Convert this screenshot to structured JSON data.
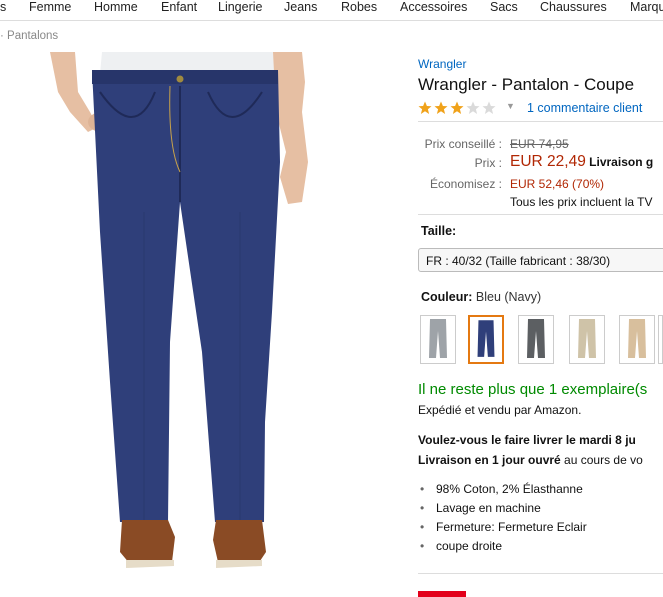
{
  "nav": {
    "items": [
      "s",
      "Femme",
      "Homme",
      "Enfant",
      "Lingerie",
      "Jeans",
      "Robes",
      "Accessoires",
      "Sacs",
      "Chaussures",
      "Marqu"
    ]
  },
  "breadcrumb": "· Pantalons",
  "product": {
    "brand": "Wrangler",
    "title": "Wrangler - Pantalon - Coupe",
    "rating": 3,
    "rating_max": 5,
    "reviews": "1 commentaire client"
  },
  "price": {
    "list_label": "Prix conseillé :",
    "list_value": "EUR 74,95",
    "price_label": "Prix :",
    "price_value": "EUR 22,49",
    "shipping": "Livraison g",
    "save_label": "Économisez :",
    "save_value": "EUR 52,46 (70%)",
    "tax_note": "Tous les prix incluent la TV"
  },
  "size": {
    "label": "Taille:",
    "selected": "FR : 40/32 (Taille fabricant : 38/30)"
  },
  "color": {
    "label": "Couleur:",
    "selected": "Bleu (Navy)",
    "swatches": [
      "grey",
      "navy",
      "charcoal",
      "beige",
      "tan",
      "dark"
    ]
  },
  "stock": {
    "message": "Il ne reste plus que 1 exemplaire(s",
    "sold_by": "Expédié et vendu par Amazon."
  },
  "delivery": {
    "line1": "Voulez-vous le faire livrer le mardi 8 ju",
    "line2_bold": "Livraison en 1 jour ouvré",
    "line2_rest": " au cours de vo"
  },
  "features": [
    "98% Coton, 2% Élasthanne",
    "Lavage en machine",
    "Fermeture: Fermeture Eclair",
    "coupe droite"
  ]
}
